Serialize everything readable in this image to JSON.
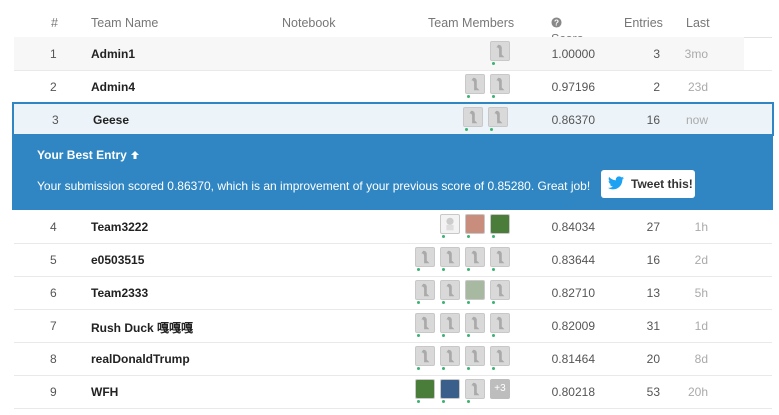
{
  "header": {
    "rank": "#",
    "team_name": "Team Name",
    "notebook": "Notebook",
    "team_members": "Team Members",
    "score": "Score",
    "entries": "Entries",
    "last": "Last"
  },
  "rows": [
    {
      "rank": "1",
      "team": "Admin1",
      "score": "1.00000",
      "entries": "3",
      "last": "3mo"
    },
    {
      "rank": "2",
      "team": "Admin4",
      "score": "0.97196",
      "entries": "2",
      "last": "23d"
    },
    {
      "rank": "3",
      "team": "Geese",
      "score": "0.86370",
      "entries": "16",
      "last": "now"
    },
    {
      "rank": "4",
      "team": "Team3222",
      "score": "0.84034",
      "entries": "27",
      "last": "1h"
    },
    {
      "rank": "5",
      "team": "e0503515",
      "score": "0.83644",
      "entries": "16",
      "last": "2d"
    },
    {
      "rank": "6",
      "team": "Team2333",
      "score": "0.82710",
      "entries": "13",
      "last": "5h"
    },
    {
      "rank": "7",
      "team": "Rush Duck 嘎嘎嘎",
      "score": "0.82009",
      "entries": "31",
      "last": "1d"
    },
    {
      "rank": "8",
      "team": "realDonaldTrump",
      "score": "0.81464",
      "entries": "20",
      "last": "8d"
    },
    {
      "rank": "9",
      "team": "WFH",
      "score": "0.80218",
      "entries": "53",
      "last": "20h"
    }
  ],
  "banner": {
    "title": "Your Best Entry",
    "message": "Your submission scored 0.86370, which is an improvement of your previous score of 0.85280. Great job!",
    "tweet_label": "Tweet this!"
  },
  "extra_members_badge": "+3",
  "colors": {
    "accent": "#2f86c2",
    "selected_bg": "#ecf4fa"
  }
}
